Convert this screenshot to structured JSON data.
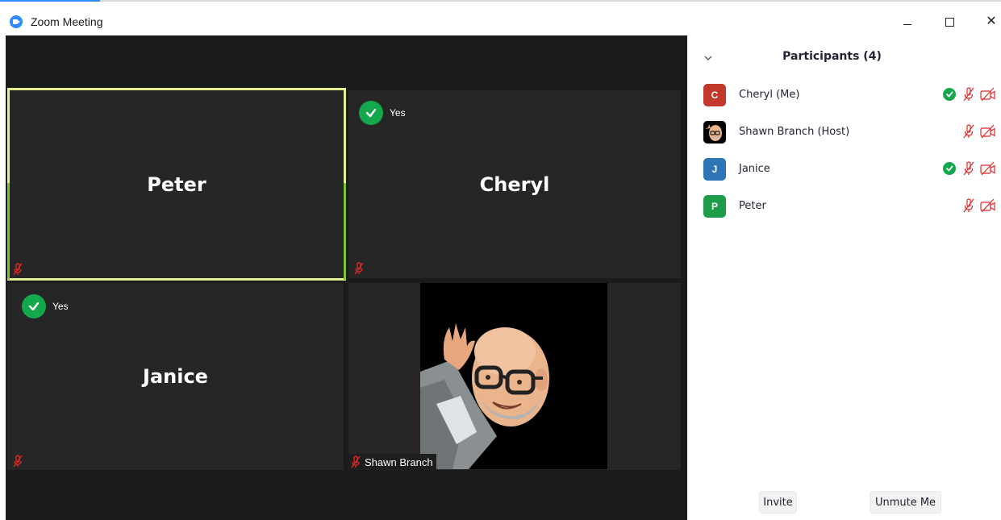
{
  "window": {
    "title": "Zoom Meeting",
    "controls": [
      "minimize",
      "maximize",
      "close"
    ]
  },
  "colors": {
    "brand_blue": "#2d8cff",
    "active_speaker_border": "#e6f091",
    "reaction_green": "#12a84b",
    "muted_red": "#e02828",
    "tile_bg": "#262626"
  },
  "video": {
    "tiles": [
      {
        "name": "Peter",
        "active_speaker": true,
        "muted": true,
        "reaction": null
      },
      {
        "name": "Cheryl",
        "active_speaker": false,
        "muted": true,
        "reaction": "Yes"
      },
      {
        "name": "Janice",
        "active_speaker": false,
        "muted": true,
        "reaction": "Yes"
      },
      {
        "name": "Shawn Branch",
        "active_speaker": false,
        "muted": true,
        "reaction": null,
        "has_video": true,
        "nametag": "Shawn Branch"
      }
    ]
  },
  "participants": {
    "title": "Participants (4)",
    "list": [
      {
        "initial": "C",
        "name": "Cheryl (Me)",
        "avatar_color": "#c0392b",
        "yes": true,
        "mic_muted": true,
        "video_off": true
      },
      {
        "initial": "",
        "name": "Shawn Branch (Host)",
        "avatar_color": "#000000",
        "yes": false,
        "mic_muted": true,
        "video_off": true
      },
      {
        "initial": "J",
        "name": "Janice",
        "avatar_color": "#2e75b6",
        "yes": true,
        "mic_muted": true,
        "video_off": true
      },
      {
        "initial": "P",
        "name": "Peter",
        "avatar_color": "#1e9e4a",
        "yes": false,
        "mic_muted": true,
        "video_off": true
      }
    ],
    "buttons": {
      "invite": "Invite",
      "unmute": "Unmute Me"
    }
  },
  "icons": {
    "collapse": "chevron-down-icon",
    "reaction": "check-icon",
    "mic": "mic-muted-icon",
    "camera": "video-off-icon"
  }
}
